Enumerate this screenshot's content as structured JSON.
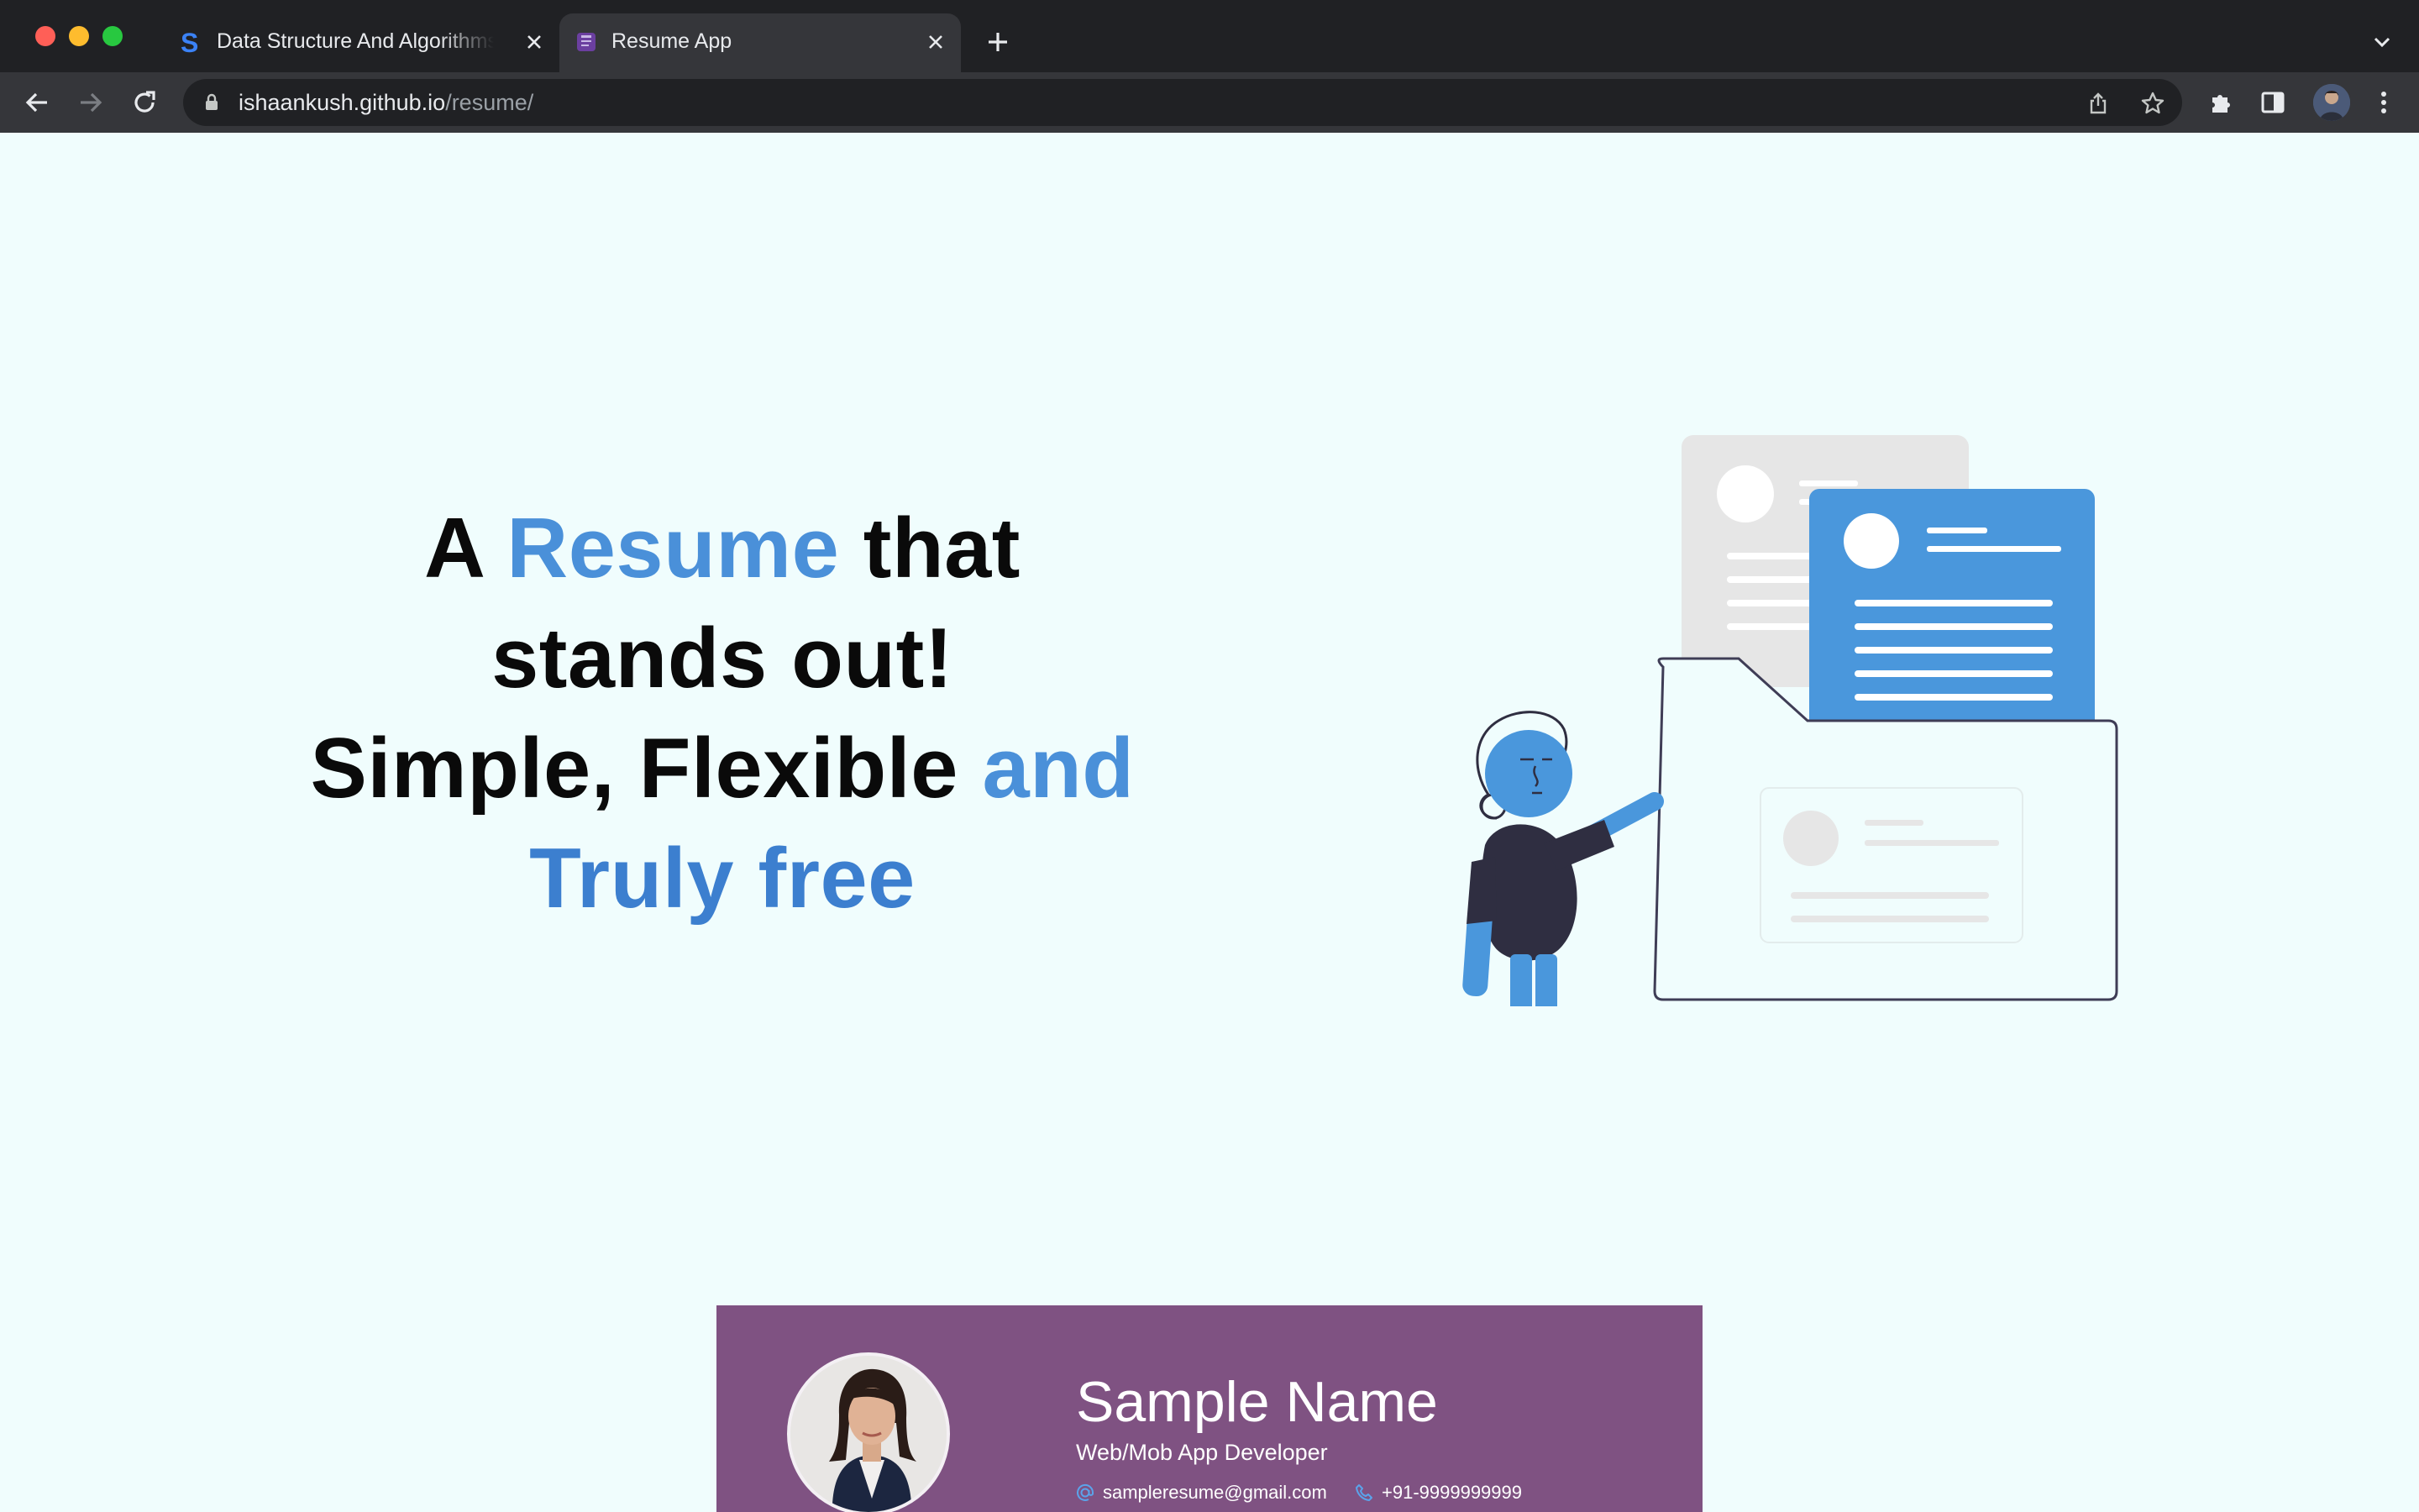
{
  "browser": {
    "tabs": [
      {
        "title": "Data Structure And Algorithms",
        "favicon": "s-logo-icon",
        "active": false
      },
      {
        "title": "Resume App",
        "favicon": "resume-app-icon",
        "active": true
      }
    ],
    "address": {
      "host": "ishaankush.github.io",
      "path": "/resume/"
    }
  },
  "hero": {
    "line1": {
      "prefix": "A ",
      "accent": "Resume",
      "suffix": " that"
    },
    "line2": "stands out!",
    "line3": {
      "prefix": "Simple, Flexible ",
      "accent": "and"
    },
    "line4": "Truly free"
  },
  "resume_preview": {
    "name": "Sample Name",
    "role": "Web/Mob App Developer",
    "email": "sampleresume@gmail.com",
    "phone": "+91-9999999999"
  },
  "colors": {
    "accent_light": "#4a90d9",
    "accent_dark": "#3c7fcf",
    "page_background": "#f0fdfd",
    "resume_header": "#7f5282",
    "illustration_blue": "#4a97dc",
    "browser_dark": "#202124",
    "browser_toolbar": "#35363a"
  },
  "icons": {
    "back": "arrow-left-icon",
    "forward": "arrow-right-icon",
    "reload": "reload-icon",
    "lock": "lock-icon",
    "share": "share-icon",
    "bookmark": "star-icon",
    "extensions": "puzzle-icon",
    "side_panel": "side-panel-icon",
    "menu": "kebab-menu-icon"
  }
}
